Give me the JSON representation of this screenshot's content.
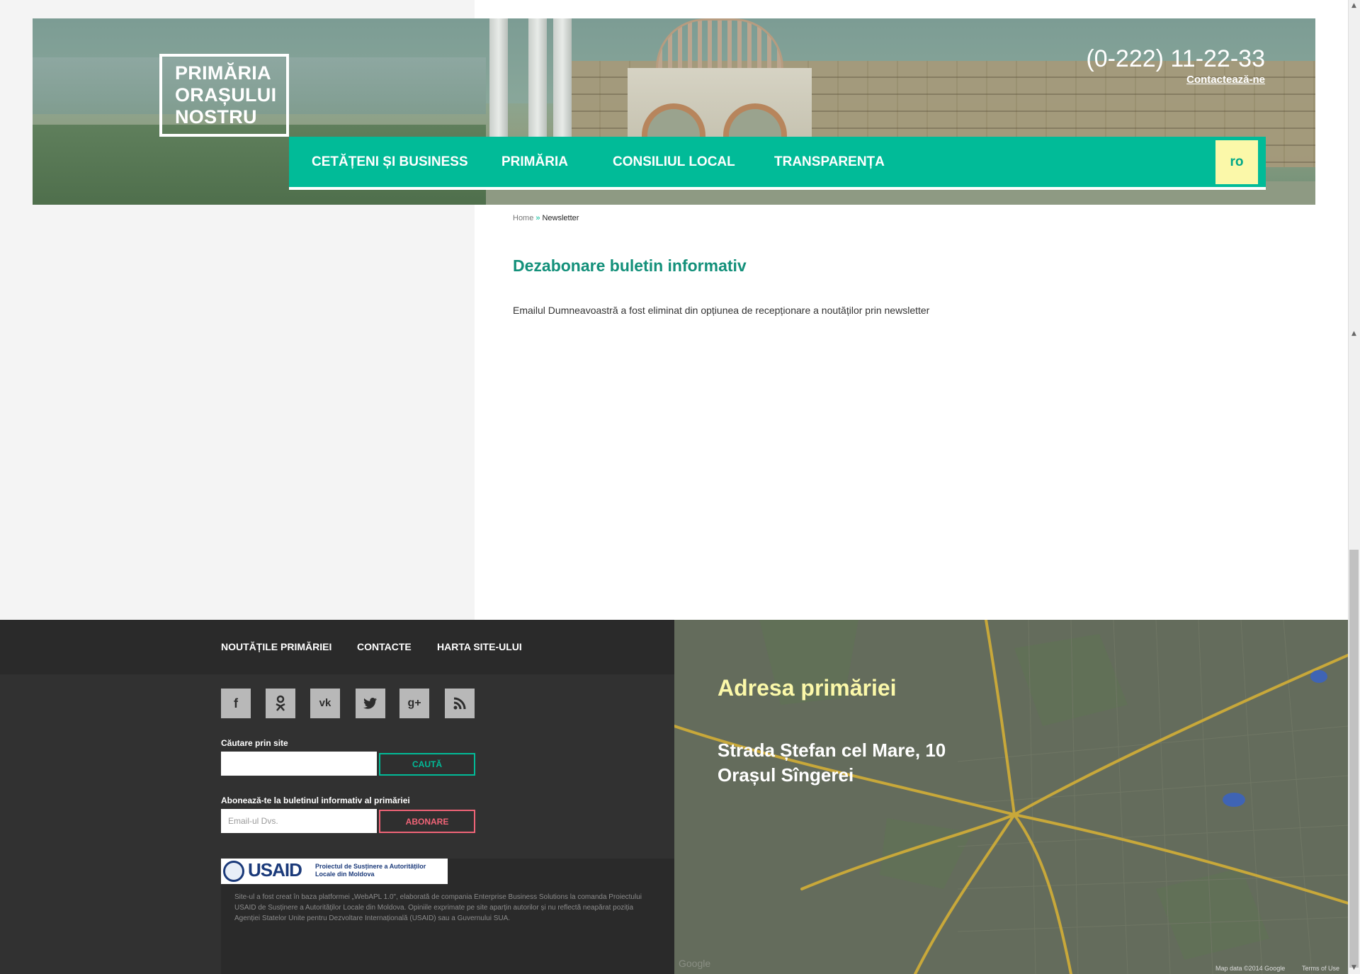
{
  "header": {
    "logo_lines": [
      "PRIMĂRIA",
      "ORAȘULUI",
      "NOSTRU"
    ],
    "phone": "(0-222) 11-22-33",
    "contact_link": "Contactează-ne"
  },
  "nav": {
    "items": [
      "CETĂȚENI ȘI BUSINESS",
      "PRIMĂRIA",
      "CONSILIUL LOCAL",
      "TRANSPARENȚA"
    ],
    "lang": "ro"
  },
  "breadcrumb": {
    "home": "Home",
    "separator": "»",
    "current": "Newsletter"
  },
  "content": {
    "title": "Dezabonare buletin informativ",
    "message": "Emailul Dumneavoastră a fost eliminat din opțiunea de recepționare a noutăților prin newsletter"
  },
  "footer": {
    "links": [
      "NOUTĂȚILE PRIMĂRIEI",
      "CONTACTE",
      "HARTA SITE-ULUI"
    ],
    "social_icons": [
      "facebook-icon",
      "odnoklassniki-icon",
      "vk-icon",
      "twitter-icon",
      "google-plus-icon",
      "rss-icon"
    ],
    "search": {
      "label": "Căutare prin site",
      "value": "",
      "button": "CAUTĂ"
    },
    "newsletter": {
      "label": "Abonează-te la buletinul informativ al primăriei",
      "placeholder": "Email-ul Dvs.",
      "button": "ABONARE"
    },
    "usaid": {
      "name": "USAID",
      "project": "Proiectul de Susținere a Autorităților Locale din Moldova"
    },
    "disclaimer": "Site-ul a fost creat în baza platformei „WebAPL 1.0\", elaborată de compania Enterprise Business Solutions la comanda Proiectului USAID de Susținere a Autorităților Locale din Moldova. Opiniile exprimate pe site aparțin autorilor și nu reflectă neapărat poziția Agenției Statelor Unite pentru Dezvoltare Internațională (USAID) sau a Guvernului SUA."
  },
  "map": {
    "title": "Adresa primăriei",
    "address_line1": "Strada Ștefan cel Mare, 10",
    "address_line2": "Orașul Sîngerei",
    "credit": "Map data ©2014 Google",
    "terms": "Terms of Use",
    "watermark": "Google"
  },
  "colors": {
    "accent": "#01bb98",
    "lang_bg": "#fbf8a9",
    "subscribe": "#f06477",
    "footer_bg": "#313131"
  }
}
